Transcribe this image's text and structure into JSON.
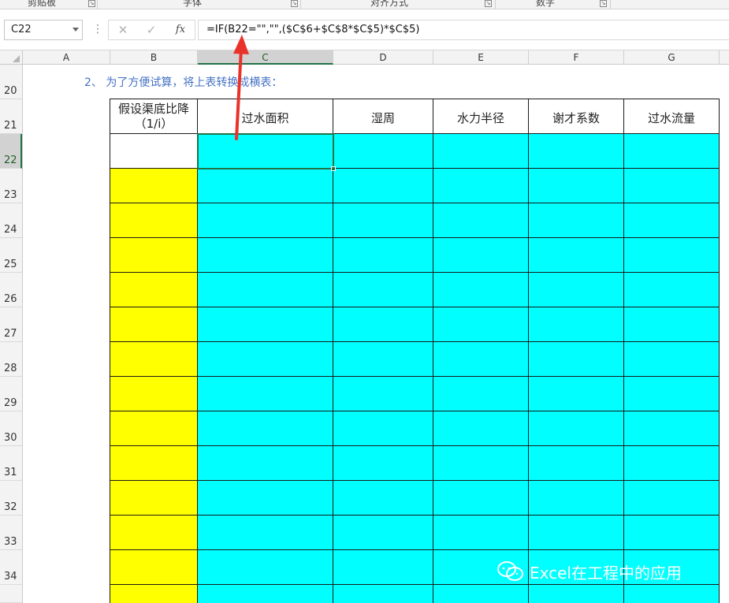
{
  "ribbon": {
    "groups": [
      {
        "label": "剪贴板"
      },
      {
        "label": "字体"
      },
      {
        "label": "对齐方式"
      },
      {
        "label": "数字"
      }
    ]
  },
  "formula_bar": {
    "name_box": "C22",
    "cancel_icon": "✕",
    "enter_icon": "✓",
    "fx_label": "fx",
    "formula": "=IF(B22=\"\",\"\",($C$6+$C$8*$C$5)*$C$5)"
  },
  "columns": [
    "A",
    "B",
    "C",
    "D",
    "E",
    "F",
    "G"
  ],
  "selected_column": "C",
  "rows": [
    "20",
    "21",
    "22",
    "23",
    "24",
    "25",
    "26",
    "27",
    "28",
    "29",
    "30",
    "31",
    "32",
    "33",
    "34"
  ],
  "selected_row": "22",
  "note": "2、 为了方便试算，将上表转换成横表：",
  "table": {
    "header_b_line1": "假设渠底比降",
    "header_b_line2": "（1/i）",
    "headers": [
      "过水面积",
      "湿周",
      "水力半径",
      "谢才系数",
      "过水流量"
    ]
  },
  "colors": {
    "input_column": "#ffff00",
    "calc_cells": "#00ffff",
    "selection": "#217346",
    "note_text": "#4472c4",
    "annotation_arrow": "#e8322a"
  },
  "watermark": {
    "text": "Excel在工程中的应用",
    "icon": "wechat-icon"
  }
}
